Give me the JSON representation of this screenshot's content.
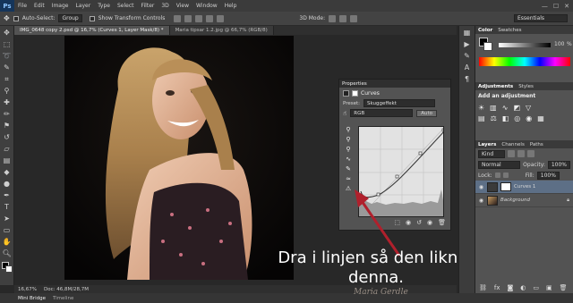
{
  "app": {
    "logo": "Ps",
    "window_controls": [
      "—",
      "☐",
      "✕"
    ]
  },
  "menu": [
    "File",
    "Edit",
    "Image",
    "Layer",
    "Type",
    "Select",
    "Filter",
    "3D",
    "View",
    "Window",
    "Help"
  ],
  "options_bar": {
    "auto_select_label": "Auto-Select:",
    "auto_select_value": "Group",
    "show_transform": "Show Transform Controls",
    "mode_3d": "3D Mode:",
    "workspace": "Essentials"
  },
  "doc_tabs": [
    {
      "label": "IMG_0648 copy 2.psd @ 16,7% (Curves 1, Layer Mask/8) *",
      "active": true
    },
    {
      "label": "Maria tipsar 1.2.jpg @ 66,7% (RGB/8)",
      "active": false
    }
  ],
  "status": {
    "zoom": "16,67%",
    "doc": "Doc: 46,8M/28,7M"
  },
  "bottom_tabs": [
    "Mini Bridge",
    "Timeline"
  ],
  "properties": {
    "panel_title": "Properties",
    "adj_name": "Curves",
    "preset_label": "Preset:",
    "preset_value": "Skuggeffekt",
    "channel": "RGB",
    "auto": "Auto"
  },
  "color_panel": {
    "tabs": [
      "Color",
      "Swatches"
    ],
    "value": "100",
    "pct": "%"
  },
  "adjustments": {
    "tabs": [
      "Adjustments",
      "Styles"
    ],
    "hint": "Add an adjustment"
  },
  "layers": {
    "tabs": [
      "Layers",
      "Channels",
      "Paths"
    ],
    "kind": "Kind",
    "blend": "Normal",
    "opacity_label": "Opacity:",
    "opacity": "100%",
    "lock_label": "Lock:",
    "fill_label": "Fill:",
    "fill": "100%",
    "items": [
      {
        "name": "Curves 1",
        "selected": true
      },
      {
        "name": "Background",
        "selected": false
      }
    ]
  },
  "annotation": {
    "line1": "Dra i linjen så den liknar",
    "line2": "denna."
  },
  "watermark": "Maria Gerdle",
  "colors": {
    "accent": "#5d6f86",
    "arrow": "#b0202c"
  }
}
